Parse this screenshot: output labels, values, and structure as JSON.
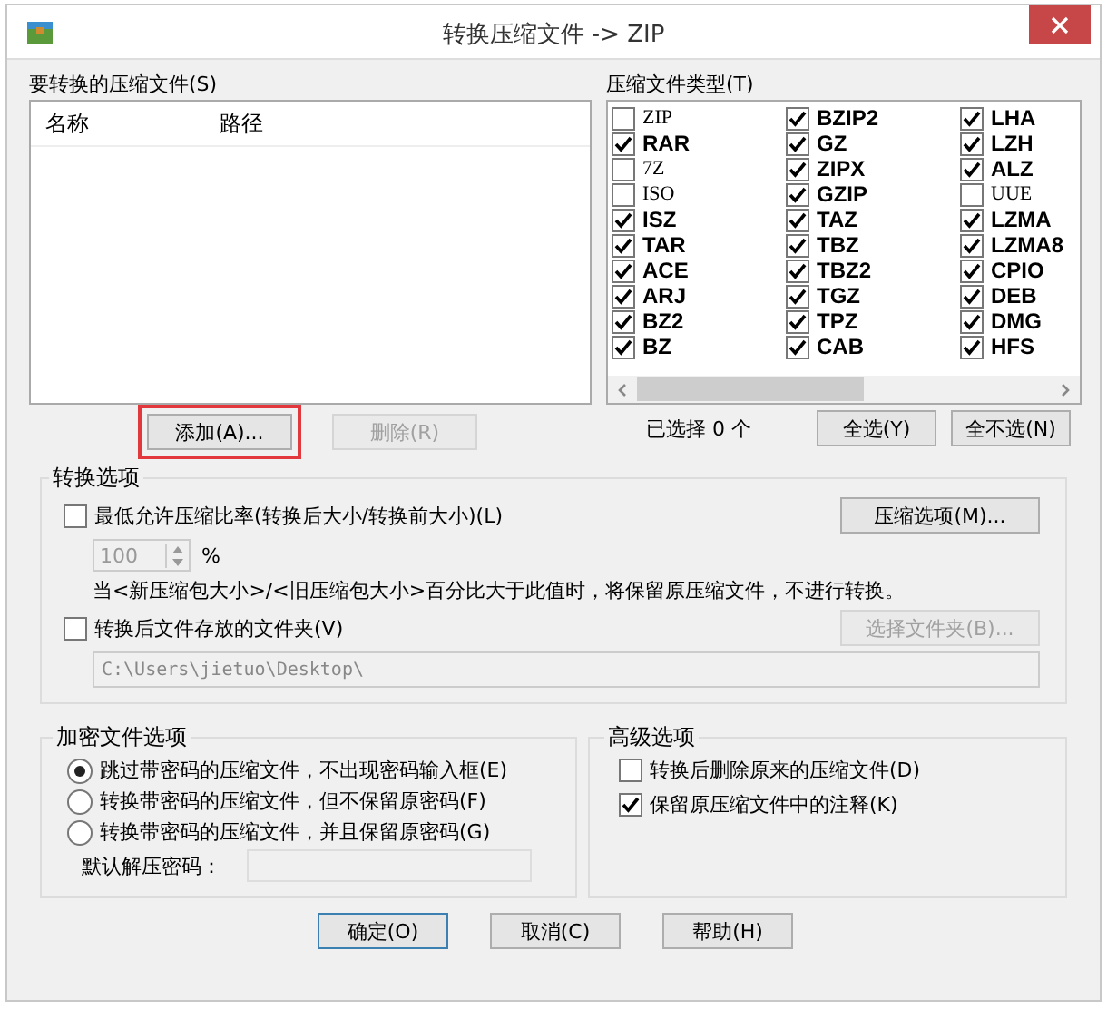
{
  "window": {
    "title": "转换压缩文件 -> ZIP"
  },
  "files": {
    "label": "要转换的压缩文件(S)",
    "columns": [
      "名称",
      "路径"
    ],
    "buttons": [
      {
        "label": "添加(A)...",
        "disabled": false,
        "highlighted": true
      },
      {
        "label": "删除(R)",
        "disabled": true,
        "highlighted": false
      }
    ]
  },
  "types": {
    "label": "压缩文件类型(T)",
    "columns": [
      [
        {
          "label": "ZIP",
          "checked": false
        },
        {
          "label": "RAR",
          "checked": true
        },
        {
          "label": "7Z",
          "checked": false
        },
        {
          "label": "ISO",
          "checked": false
        },
        {
          "label": "ISZ",
          "checked": true
        },
        {
          "label": "TAR",
          "checked": true
        },
        {
          "label": "ACE",
          "checked": true
        },
        {
          "label": "ARJ",
          "checked": true
        },
        {
          "label": "BZ2",
          "checked": true
        },
        {
          "label": "BZ",
          "checked": true
        }
      ],
      [
        {
          "label": "BZIP2",
          "checked": true
        },
        {
          "label": "GZ",
          "checked": true
        },
        {
          "label": "ZIPX",
          "checked": true
        },
        {
          "label": "GZIP",
          "checked": true
        },
        {
          "label": "TAZ",
          "checked": true
        },
        {
          "label": "TBZ",
          "checked": true
        },
        {
          "label": "TBZ2",
          "checked": true
        },
        {
          "label": "TGZ",
          "checked": true
        },
        {
          "label": "TPZ",
          "checked": true
        },
        {
          "label": "CAB",
          "checked": true
        }
      ],
      [
        {
          "label": "LHA",
          "checked": true
        },
        {
          "label": "LZH",
          "checked": true
        },
        {
          "label": "ALZ",
          "checked": true
        },
        {
          "label": "UUE",
          "checked": false
        },
        {
          "label": "LZMA",
          "checked": true
        },
        {
          "label": "LZMA8",
          "checked": true
        },
        {
          "label": "CPIO",
          "checked": true
        },
        {
          "label": "DEB",
          "checked": true
        },
        {
          "label": "DMG",
          "checked": true
        },
        {
          "label": "HFS",
          "checked": true
        }
      ]
    ],
    "count": "已选择 0 个",
    "buttons": [
      "全选(Y)",
      "全不选(N)"
    ]
  },
  "convert": {
    "title": "转换选项",
    "min_ratio": {
      "label": "最低允许压缩比率(转换后大小/转换前大小)(L)",
      "checked": false
    },
    "ratio_value": "100",
    "ratio_unit": "%",
    "compress_button": "压缩选项(M)...",
    "note": "当<新压缩包大小>/<旧压缩包大小>百分比大于此值时，将保留原压缩文件，不进行转换。",
    "folder": {
      "label": "转换后文件存放的文件夹(V)",
      "checked": false
    },
    "folder_button": {
      "label": "选择文件夹(B)...",
      "disabled": true
    },
    "folder_path": "C:\\Users\\jietuo\\Desktop\\"
  },
  "encryption": {
    "title": "加密文件选项",
    "options": [
      {
        "label": "跳过带密码的压缩文件，不出现密码输入框(E)",
        "selected": true
      },
      {
        "label": "转换带密码的压缩文件，但不保留原密码(F)",
        "selected": false
      },
      {
        "label": "转换带密码的压缩文件，并且保留原密码(G)",
        "selected": false
      }
    ],
    "password_label": "默认解压密码："
  },
  "advanced": {
    "title": "高级选项",
    "options": [
      {
        "label": "转换后删除原来的压缩文件(D)",
        "checked": false
      },
      {
        "label": "保留原压缩文件中的注释(K)",
        "checked": true
      }
    ]
  },
  "buttons": [
    {
      "label": "确定(O)",
      "default": true
    },
    {
      "label": "取消(C)",
      "default": false
    },
    {
      "label": "帮助(H)",
      "default": false
    }
  ]
}
